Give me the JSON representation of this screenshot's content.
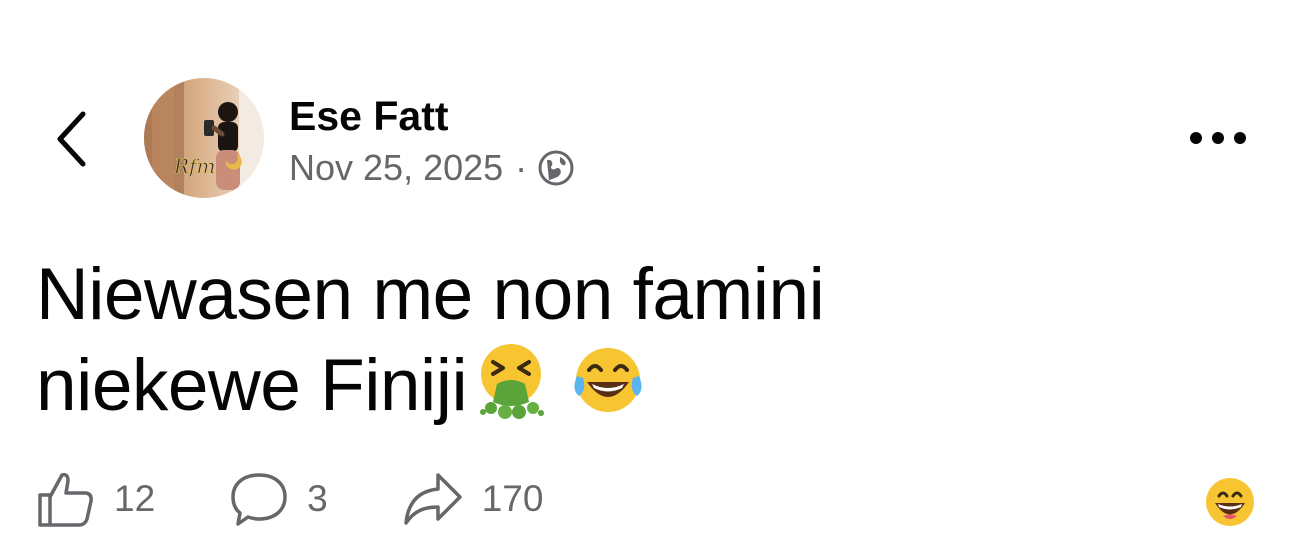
{
  "header": {
    "author_name": "Ese Fatt",
    "date": "Nov 25, 2025",
    "separator": "·",
    "privacy_icon": "globe-icon",
    "back_icon": "chevron-left-icon",
    "more_icon": "more-horizontal-icon",
    "avatar_watermark": "Rfm"
  },
  "post": {
    "text_line_1": "Niewasen me non famini",
    "text_line_2": "niekewe Finiji",
    "emojis": [
      "vomiting-face-emoji",
      "tears-of-joy-emoji"
    ]
  },
  "actions": {
    "like_count": "12",
    "comment_count": "3",
    "share_count": "170",
    "reaction_emoji": "grinning-face-emoji"
  },
  "colors": {
    "text_primary": "#050505",
    "text_secondary": "#65676b",
    "background": "#ffffff"
  }
}
